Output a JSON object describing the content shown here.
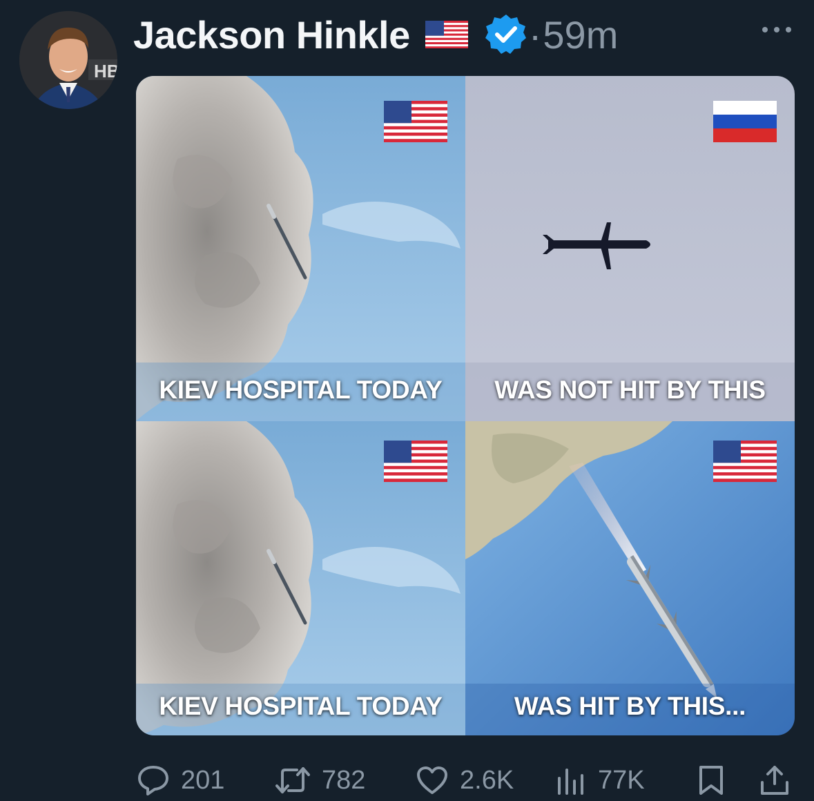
{
  "post": {
    "author_name": "Jackson Hinkle",
    "flag_emoji": "us-flag",
    "verified": true,
    "separator": "·",
    "time": "59m"
  },
  "media": {
    "panels": [
      {
        "caption": "KIEV HOSPITAL TODAY",
        "flag": "us-flag",
        "scene": "cloud-and-missile"
      },
      {
        "caption": "WAS NOT HIT BY THIS",
        "flag": "russia-flag",
        "scene": "missile-silhouette-gray-sky"
      },
      {
        "caption": "KIEV HOSPITAL TODAY",
        "flag": "us-flag",
        "scene": "cloud-and-missile"
      },
      {
        "caption": "WAS HIT BY THIS...",
        "flag": "us-flag",
        "scene": "missile-launch-blue-sky"
      }
    ]
  },
  "actions": {
    "replies": "201",
    "reposts": "782",
    "likes": "2.6K",
    "views": "77K"
  },
  "colors": {
    "background": "#15202b",
    "muted": "#8b98a5",
    "verified_blue": "#1d9bf0"
  }
}
